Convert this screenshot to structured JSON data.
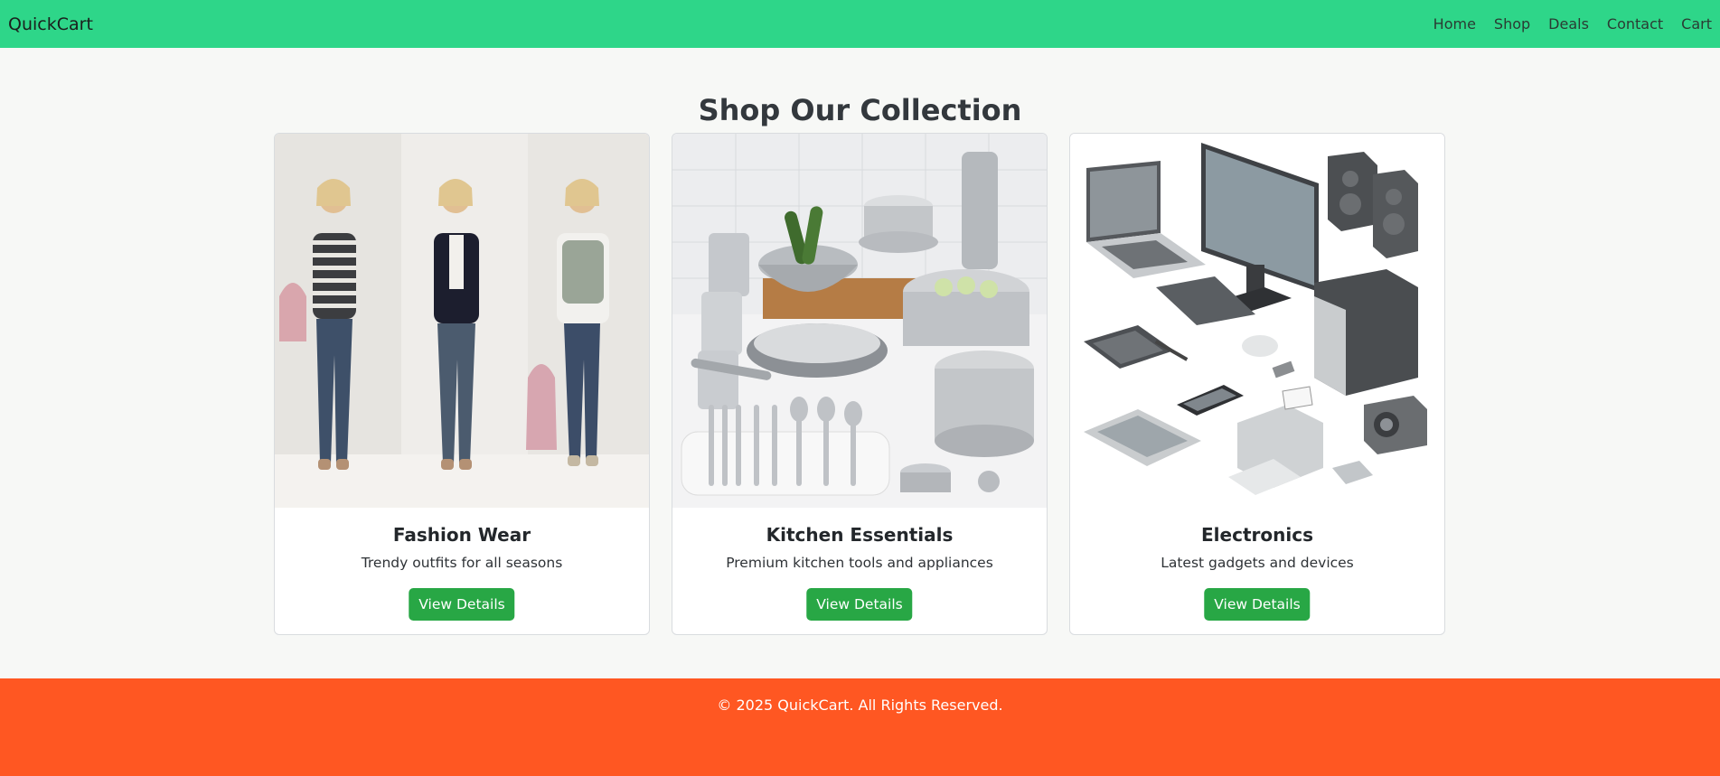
{
  "navbar": {
    "brand": "QuickCart",
    "links": [
      "Home",
      "Shop",
      "Deals",
      "Contact",
      "Cart"
    ]
  },
  "main": {
    "title": "Shop Our Collection",
    "cards": [
      {
        "title": "Fashion Wear",
        "text": "Trendy outfits for all seasons",
        "button": "View Details",
        "image": "fashion-photo"
      },
      {
        "title": "Kitchen Essentials",
        "text": "Premium kitchen tools and appliances",
        "button": "View Details",
        "image": "kitchen-photo"
      },
      {
        "title": "Electronics",
        "text": "Latest gadgets and devices",
        "button": "View Details",
        "image": "electronics-illustration"
      }
    ]
  },
  "footer": {
    "text": "© 2025 QuickCart. All Rights Reserved."
  },
  "colors": {
    "navbar": "#2ed689",
    "footer": "#ff5722",
    "button": "#28a745",
    "background": "#f7f8f6"
  }
}
